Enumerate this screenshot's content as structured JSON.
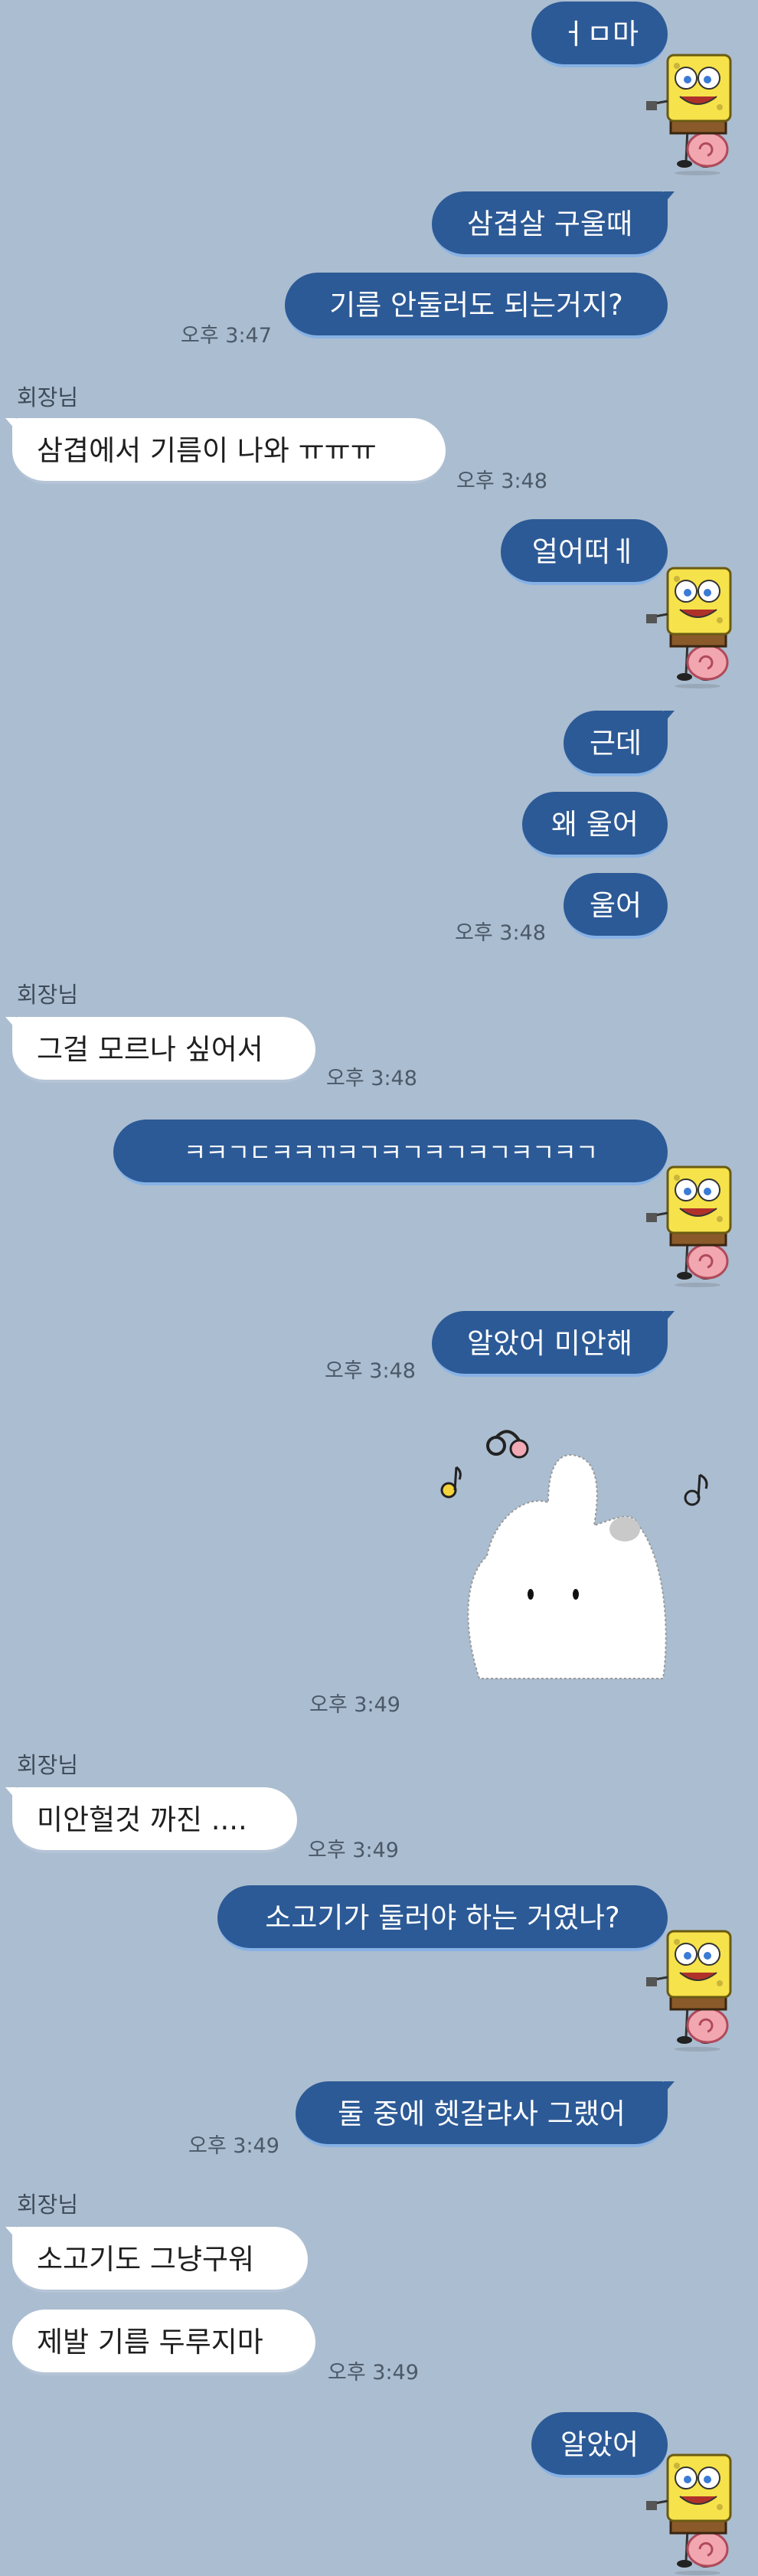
{
  "sender_name": "회장님",
  "colors": {
    "background": "#abbdd0",
    "my_bubble": "#2c5a96",
    "their_bubble": "#ffffff"
  },
  "messages": [
    {
      "side": "me",
      "text": "ㅓㅁ마"
    },
    {
      "side": "me",
      "text": "삼겹살 구울때"
    },
    {
      "side": "me",
      "text": "기름 안둘러도 되는거지?",
      "time": "오후 3:47"
    },
    {
      "side": "them",
      "text": "삼겹에서 기름이 나와 ㅠㅠㅠ",
      "time": "오후 3:48"
    },
    {
      "side": "me",
      "text": "얼어떠ㅔ"
    },
    {
      "side": "me",
      "text": "근데"
    },
    {
      "side": "me",
      "text": "왜 울어"
    },
    {
      "side": "me",
      "text": "울어",
      "time": "오후 3:48"
    },
    {
      "side": "them",
      "text": "그걸 모르나 싶어서",
      "time": "오후 3:48"
    },
    {
      "side": "me",
      "text": "ㅋㅋㄱㄷㅋㅋㄲㅋㄱㅋㄱㅋㄱㅋㄱㅋㄱㅋㄱ"
    },
    {
      "side": "me",
      "text": "알았어 미안해",
      "time": "오후 3:48"
    },
    {
      "side": "me",
      "sticker": "bunny-sticker",
      "time": "오후 3:49"
    },
    {
      "side": "them",
      "text": "미안헐것 까진 ....",
      "time": "오후 3:49"
    },
    {
      "side": "me",
      "text": "소고기가 둘러야 하는 거였나?"
    },
    {
      "side": "me",
      "text": "둘 중에 헷갈랴사 그랬어",
      "time": "오후 3:49"
    },
    {
      "side": "them",
      "text": "소고기도 그냥구워"
    },
    {
      "side": "them",
      "text": "제발 기름 두루지마",
      "time": "오후 3:49"
    },
    {
      "side": "me",
      "text": "알았어"
    }
  ]
}
